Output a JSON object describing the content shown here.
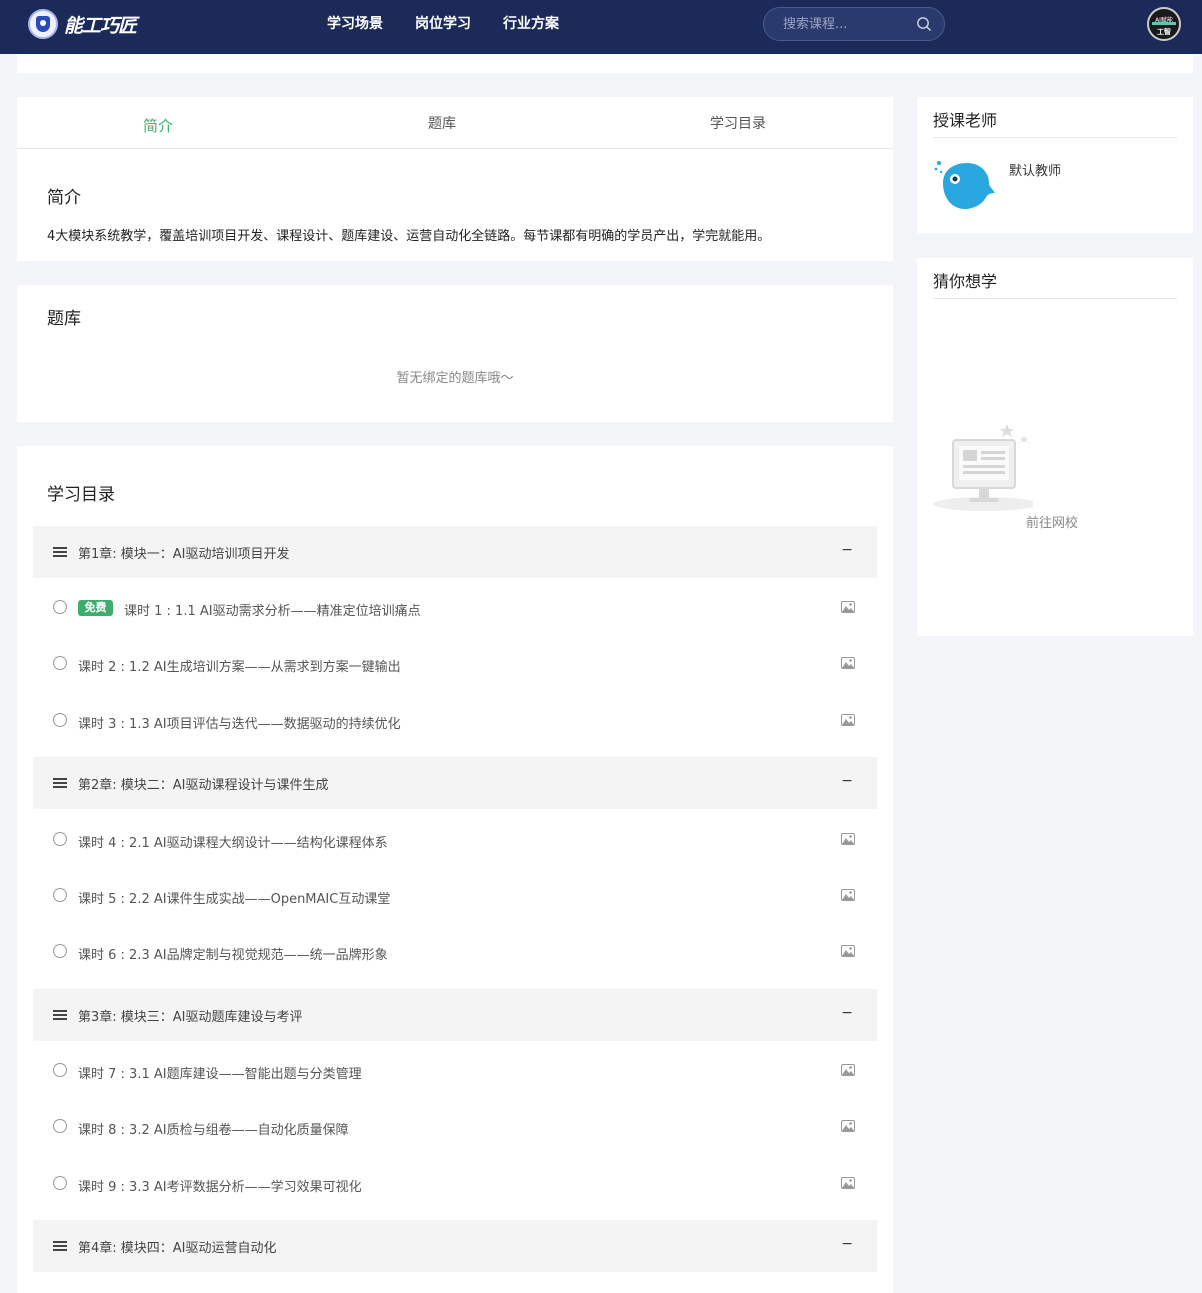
{
  "header": {
    "logo_text": "能工巧匠",
    "nav": [
      "学习场景",
      "岗位学习",
      "行业方案"
    ],
    "search_placeholder": "搜索课程...",
    "avatar_top": "AI赋能",
    "avatar_bottom": "工智"
  },
  "tabs": [
    {
      "label": "简介",
      "active": true
    },
    {
      "label": "题库",
      "active": false
    },
    {
      "label": "学习目录",
      "active": false
    }
  ],
  "intro": {
    "title": "简介",
    "text": "4大模块系统教学，覆盖培训项目开发、课程设计、题库建设、运营自动化全链路。每节课都有明确的学员产出，学完就能用。"
  },
  "question_bank": {
    "title": "题库",
    "empty_tip": "暂无绑定的题库哦～"
  },
  "catalog": {
    "title": "学习目录",
    "free_badge": "免费",
    "toggle_symbol": "−",
    "chapters": [
      {
        "title": "第1章: 模块一：AI驱动培训项目开发",
        "lessons": [
          {
            "title": "课时 1 : 1.1 AI驱动需求分析——精准定位培训痛点",
            "free": true
          },
          {
            "title": "课时 2 : 1.2 AI生成培训方案——从需求到方案一键输出",
            "free": false
          },
          {
            "title": "课时 3 : 1.3 AI项目评估与迭代——数据驱动的持续优化",
            "free": false
          }
        ]
      },
      {
        "title": "第2章: 模块二：AI驱动课程设计与课件生成",
        "lessons": [
          {
            "title": "课时 4 : 2.1 AI驱动课程大纲设计——结构化课程体系",
            "free": false
          },
          {
            "title": "课时 5 : 2.2 AI课件生成实战——OpenMAIC互动课堂",
            "free": false
          },
          {
            "title": "课时 6 : 2.3 AI品牌定制与视觉规范——统一品牌形象",
            "free": false
          }
        ]
      },
      {
        "title": "第3章: 模块三：AI驱动题库建设与考评",
        "lessons": [
          {
            "title": "课时 7 : 3.1 AI题库建设——智能出题与分类管理",
            "free": false
          },
          {
            "title": "课时 8 : 3.2 AI质检与组卷——自动化质量保障",
            "free": false
          },
          {
            "title": "课时 9 : 3.3 AI考评数据分析——学习效果可视化",
            "free": false
          }
        ]
      },
      {
        "title": "第4章: 模块四：AI驱动运营自动化",
        "lessons": []
      }
    ]
  },
  "teacher": {
    "title": "授课老师",
    "name": "默认教师"
  },
  "guess": {
    "title": "猜你想学",
    "link": "前往网校"
  },
  "colors": {
    "header_bg": "#1c2a5a",
    "accent_green": "#3dae6d",
    "teacher_avatar": "#29a8e0"
  }
}
